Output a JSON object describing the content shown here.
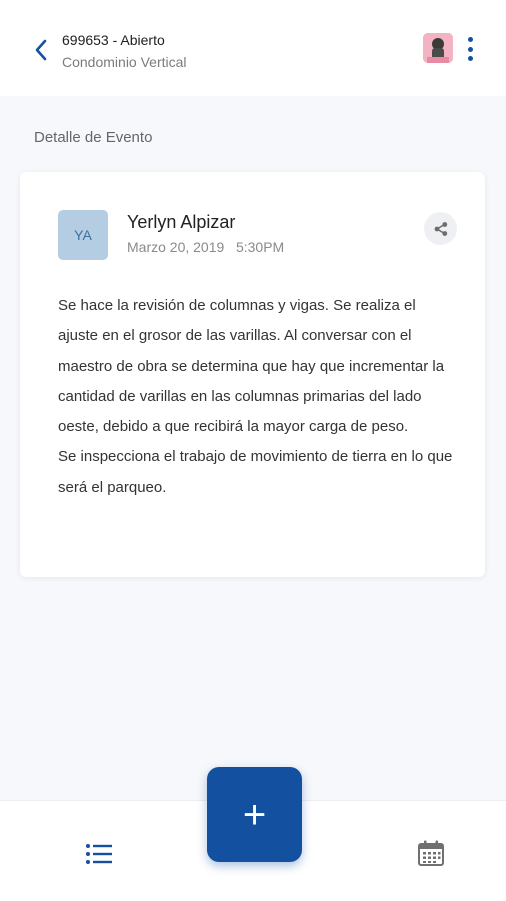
{
  "header": {
    "title": "699653 - Abierto",
    "subtitle": "Condominio Vertical",
    "back_icon": "chevron-left-icon",
    "menu_icon": "more-vert-icon",
    "accent": "#1750a0"
  },
  "section": {
    "label": "Detalle de Evento"
  },
  "event": {
    "avatar_initials": "YA",
    "author": "Yerlyn Alpizar",
    "date": "Marzo 20, 2019   5:30PM",
    "share_icon": "share-icon",
    "body": [
      "Se hace la revisión de columnas y vigas. Se realiza el ajuste en el grosor de las varillas. Al conversar con el maestro de obra se determina que hay que incrementar la cantidad de varillas en las columnas primarias del lado oeste, debido a que recibirá la mayor carga de peso.",
      "Se inspecciona el trabajo de movimiento de tierra en lo que será el parqueo."
    ]
  },
  "bottom_nav": {
    "list_icon": "list-icon",
    "calendar_icon": "calendar-icon",
    "fab_label": "+",
    "fab_color": "#1450a0"
  }
}
